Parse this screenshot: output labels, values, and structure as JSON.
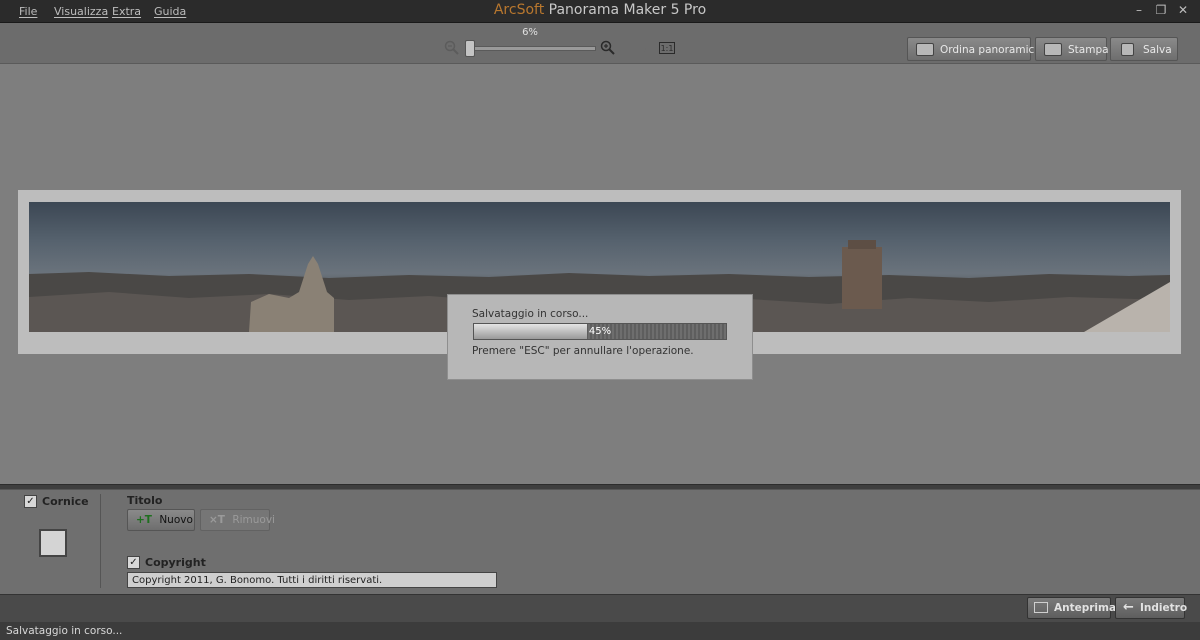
{
  "app": {
    "brand": "ArcSoft",
    "title": "Panorama Maker 5 Pro"
  },
  "menu": [
    "File",
    "Visualizza",
    "Extra",
    "Guida"
  ],
  "zoom": {
    "level": "6%",
    "fit_label": "1:1"
  },
  "toolbar": {
    "order_label": "Ordina panoramiche",
    "print_label": "Stampa",
    "save_label": "Salva"
  },
  "dialog": {
    "title": "Salvataggio in corso...",
    "progress_text": "45%",
    "progress_fraction": 0.45,
    "hint": "Premere \"ESC\" per annullare l'operazione."
  },
  "panel": {
    "frame_label": "Cornice",
    "frame_checked": true,
    "title_section": "Titolo",
    "new_button": "Nuovo",
    "remove_button": "Rimuovi",
    "copyright_label": "Copyright",
    "copyright_checked": true,
    "copyright_value": "Copyright 2011, G. Bonomo. Tutti i diritti riservati."
  },
  "footer": {
    "preview_label": "Anteprima",
    "back_label": "Indietro"
  },
  "status": {
    "text": "Salvataggio in corso..."
  },
  "colors": {
    "brand": "#b8772e",
    "background": "#7e7e7e",
    "dialog": "#b7b7b7"
  }
}
